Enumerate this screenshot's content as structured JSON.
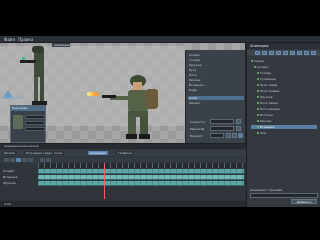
{
  "menu": {
    "items": [
      "Файл",
      "Правка"
    ],
    "document_tab": "Анимация"
  },
  "watermark": {
    "text": "ANIMATE"
  },
  "right_panel": {
    "tab_label": "Анимация",
    "tree": [
      {
        "label": "Сцена",
        "selected": false
      },
      {
        "label": "Солдат",
        "selected": false
      },
      {
        "label": "Голова",
        "selected": false
      },
      {
        "label": "Туловище",
        "selected": false
      },
      {
        "label": "Рука левая",
        "selected": false
      },
      {
        "label": "Рука правая",
        "selected": false
      },
      {
        "label": "Оружие",
        "selected": false
      },
      {
        "label": "Нога левая",
        "selected": false
      },
      {
        "label": "Нога правая",
        "selected": false
      },
      {
        "label": "Ботинок",
        "selected": false
      },
      {
        "label": "Рюкзак",
        "selected": false
      },
      {
        "label": "Вспышка",
        "selected": true
      },
      {
        "label": "Фон",
        "selected": false
      }
    ],
    "bottom_label": "Анимация: стрельба",
    "bottom_button": "Добавить"
  },
  "properties": {
    "lines": [
      "Солдат",
      "Голова",
      "Оружие",
      "Рука",
      "Нога",
      "Рюкзак",
      "Вспышка",
      "Кадр",
      "Слой",
      "Объект"
    ],
    "controls": [
      {
        "label": "Скорость"
      },
      {
        "label": "Масштаб"
      },
      {
        "label": "Поворот"
      }
    ]
  },
  "mini_panel": {
    "title": "Персонаж"
  },
  "timeline": {
    "title": "Анимационная шкала",
    "tabs": [
      "Шкала",
      "Ключевые кадры",
      "Слои",
      "Анимация",
      "Графики"
    ],
    "active_tab": 3,
    "tracks": [
      "Солдат",
      "Вспышка",
      "Оружие"
    ],
    "footer": "0:00"
  }
}
